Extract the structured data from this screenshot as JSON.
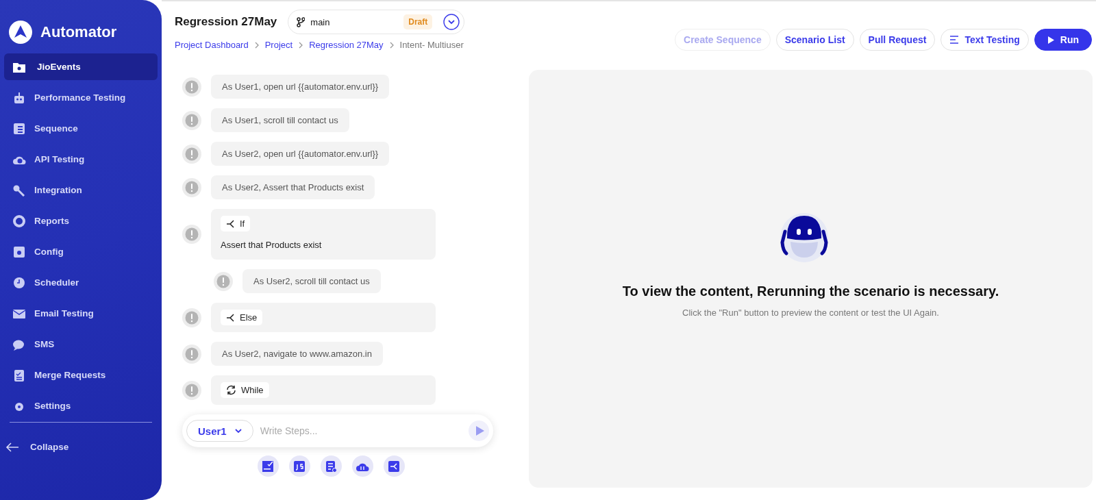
{
  "sidebar": {
    "logo": "Automator",
    "items": [
      {
        "label": "JioEvents",
        "selected": true
      },
      {
        "label": "Performance Testing",
        "selected": false
      },
      {
        "label": "Sequence",
        "selected": false
      },
      {
        "label": "API Testing",
        "selected": false
      },
      {
        "label": "Integration",
        "selected": false
      },
      {
        "label": "Reports",
        "selected": false
      },
      {
        "label": "Config",
        "selected": false
      },
      {
        "label": "Scheduler",
        "selected": false
      },
      {
        "label": "Email Testing",
        "selected": false
      },
      {
        "label": "SMS",
        "selected": false
      },
      {
        "label": "Merge Requests",
        "selected": false
      },
      {
        "label": "Settings",
        "selected": false
      }
    ],
    "collapse": "Collapse"
  },
  "header": {
    "title": "Regression 27May",
    "branch": "main",
    "status": "Draft",
    "breadcrumb": [
      {
        "label": "Project Dashboard",
        "current": false
      },
      {
        "label": "Project",
        "current": false
      },
      {
        "label": "Regression 27May",
        "current": false
      },
      {
        "label": "Intent- Multiuser",
        "current": true
      }
    ],
    "buttons": [
      {
        "label": "Create Sequence",
        "kind": "plain",
        "disabled": true
      },
      {
        "label": "Scenario List",
        "kind": "plain",
        "disabled": false
      },
      {
        "label": "Pull Request",
        "kind": "plain",
        "disabled": false
      },
      {
        "label": "Text Testing",
        "kind": "lines",
        "disabled": false
      },
      {
        "label": "Run",
        "kind": "primary",
        "disabled": false
      }
    ]
  },
  "steps": [
    {
      "kind": "step",
      "text": "As User1, open url {{automator.env.url}}"
    },
    {
      "kind": "step",
      "text": "As User1, scroll till contact us"
    },
    {
      "kind": "step",
      "text": "As User2, open url {{automator.env.url}}"
    },
    {
      "kind": "step",
      "text": "As User2, Assert that Products exist"
    },
    {
      "kind": "if",
      "label": "If",
      "text": "Assert that Products exist",
      "children": [
        {
          "kind": "step",
          "text": "As User2, scroll till contact us"
        }
      ]
    },
    {
      "kind": "else",
      "label": "Else"
    },
    {
      "kind": "step",
      "text": "As User2, navigate to www.amazon.in"
    },
    {
      "kind": "while",
      "label": "While"
    }
  ],
  "composer": {
    "user": "User1",
    "placeholder": "Write Steps..."
  },
  "preview": {
    "heading": "To view the content, Rerunning the scenario is necessary.",
    "hint": "Click the \"Run\" button to preview the content or test the UI Again."
  }
}
